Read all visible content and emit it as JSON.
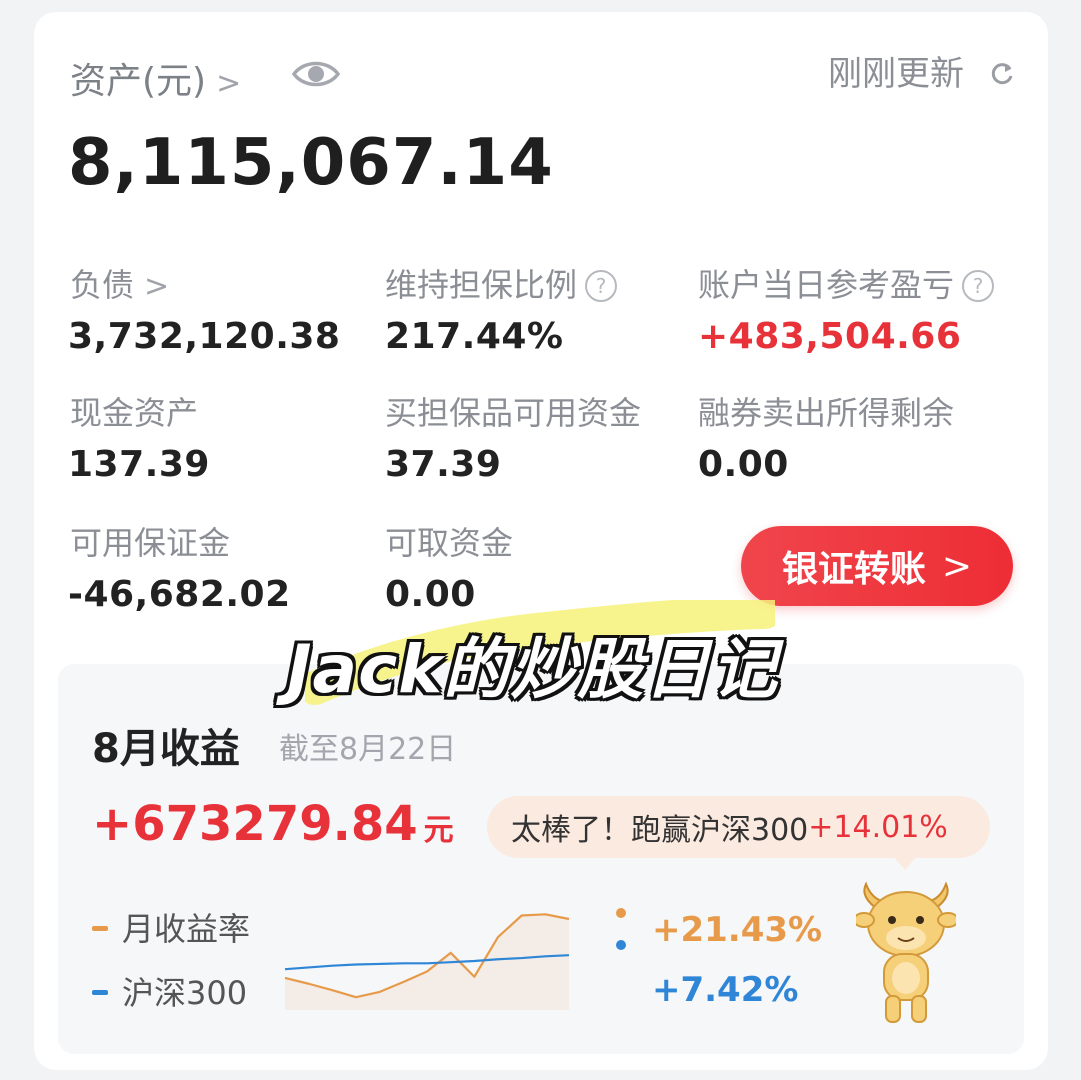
{
  "header": {
    "assets_label": "资产(元)",
    "updated_label": "刚刚更新",
    "total_assets": "8,115,067.14"
  },
  "metrics": [
    {
      "label": "负债",
      "value": "3,732,120.38"
    },
    {
      "label": "维持担保比例",
      "value": "217.44%"
    },
    {
      "label": "账户当日参考盈亏",
      "value": "+483,504.66"
    },
    {
      "label": "现金资产",
      "value": "137.39"
    },
    {
      "label": "买担保品可用资金",
      "value": "37.39"
    },
    {
      "label": "融券卖出所得剩余",
      "value": "0.00"
    },
    {
      "label": "可用保证金",
      "value": "-46,682.02"
    },
    {
      "label": "可取资金",
      "value": "0.00"
    }
  ],
  "transfer_button": "银证转账",
  "overlay_title": "Jack的炒股日记",
  "monthly": {
    "title": "8月收益",
    "as_of": "截至8月22日",
    "amount": "+673279.84",
    "unit": "元",
    "bubble_text": "太棒了！跑赢沪深300",
    "bubble_value": "+14.01%",
    "legend_return": "月收益率",
    "legend_index": "沪深300",
    "return_value": "+21.43%",
    "index_value": "+7.42%"
  },
  "colors": {
    "red": "#e8323a",
    "orange": "#e69a4a",
    "blue": "#2f86d6",
    "gray": "#8b8f95"
  },
  "icons": {
    "eye": "eye-icon",
    "refresh": "refresh-icon",
    "help": "question-circle-icon",
    "chevron": "chevron-right-icon",
    "mascot": "bull-mascot-icon"
  },
  "chart_data": {
    "type": "line",
    "series": [
      {
        "name": "月收益率",
        "color": "#e69a4a",
        "values": [
          -0.5,
          -1.5,
          -2.6,
          -3.8,
          -2.9,
          -1.2,
          0.6,
          3.8,
          -0.3,
          6.5,
          10.2,
          10.4,
          9.6
        ]
      },
      {
        "name": "沪深300",
        "color": "#2f86d6",
        "values": [
          1.0,
          1.3,
          1.6,
          1.8,
          1.9,
          2.0,
          2.0,
          2.2,
          2.4,
          2.7,
          2.9,
          3.2,
          3.4
        ]
      }
    ],
    "ylim": [
      -6,
      12
    ],
    "grid": false
  }
}
